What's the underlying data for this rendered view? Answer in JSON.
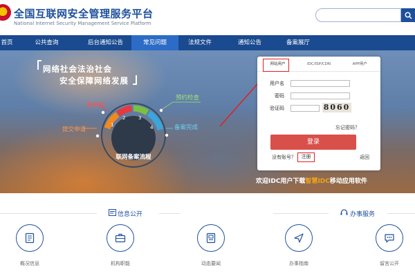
{
  "header": {
    "title": "全国互联网安全管理服务平台",
    "subtitle": "National Internet Security Management Service Platform"
  },
  "search": {
    "placeholder": ""
  },
  "nav": {
    "items": [
      {
        "label": "首页"
      },
      {
        "label": "公共查询"
      },
      {
        "label": "后台通知公告"
      },
      {
        "label": "常见问题"
      },
      {
        "label": "法规文件"
      },
      {
        "label": "通知公告"
      },
      {
        "label": "备案展厅"
      }
    ],
    "active_index": 3
  },
  "banner": {
    "title_line1": "网络社会法治社会",
    "title_line2": "安全保障网络发展",
    "flow": {
      "center_label": "联网备案流程",
      "steps": [
        "提交申请",
        "等审核",
        "预约检查",
        "备案完成"
      ],
      "numbers": [
        "1",
        "2",
        "3",
        "4"
      ]
    },
    "download_prefix": "欢迎IDC用户下载",
    "download_highlight": "智慧IDC",
    "download_suffix": "移动应用软件"
  },
  "login": {
    "tabs": [
      "网站用户",
      "IDC/ISP/CDN",
      "APP用户"
    ],
    "active_tab": 0,
    "username_label": "用户名",
    "password_label": "密码",
    "captcha_label": "验证码",
    "captcha_value": "8060",
    "forgot_password": "忘记密码？",
    "login_button": "登录",
    "no_account": "没有账号？",
    "register": "注册",
    "return": "返回"
  },
  "sections": {
    "info_title": "信息公开",
    "service_title": "办事服务",
    "items": [
      {
        "label": "概况信息",
        "icon": "document-icon"
      },
      {
        "label": "机构职能",
        "icon": "briefcase-icon"
      },
      {
        "label": "动态要闻",
        "icon": "news-icon"
      },
      {
        "label": "办事指南",
        "icon": "navigation-icon"
      },
      {
        "label": "留言公开",
        "icon": "chat-icon"
      }
    ]
  },
  "colors": {
    "brand_blue": "#1d4f9c",
    "nav_bg": "#1a4a8f",
    "nav_active": "#2d6cc6",
    "login_button": "#d94f4a",
    "annotation_red": "#e02020",
    "highlight_orange": "#f0a21c"
  }
}
